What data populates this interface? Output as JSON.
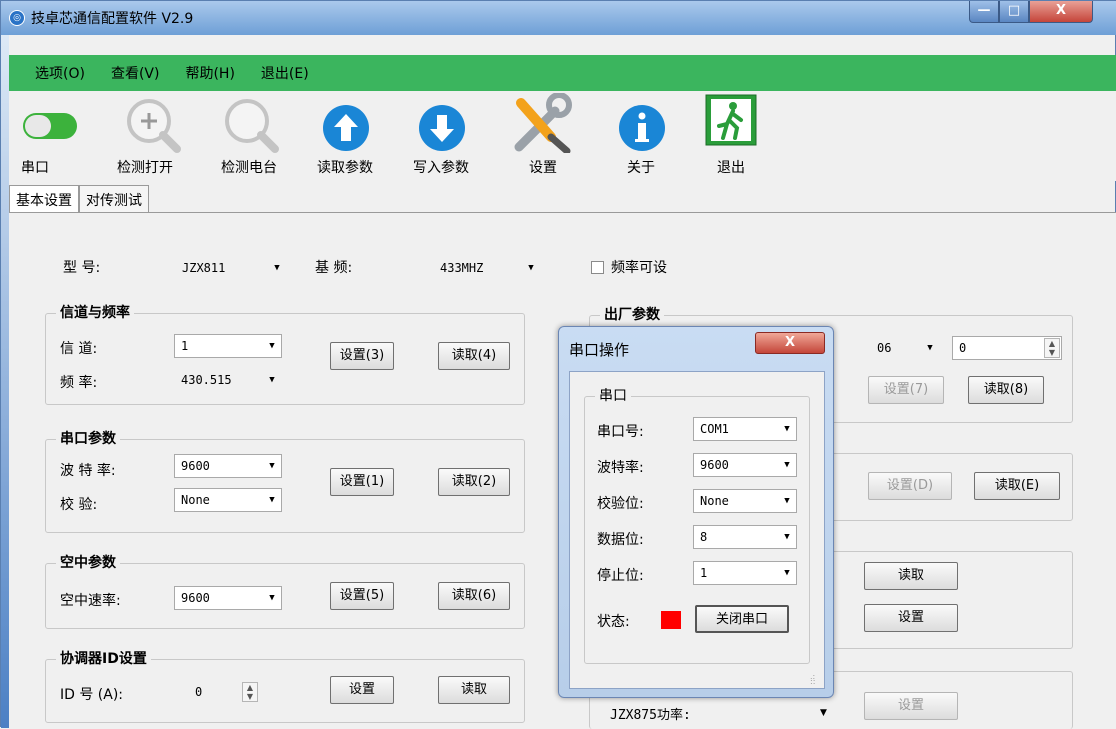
{
  "window": {
    "title": "技卓芯通信配置软件 V2.9",
    "app_icon": "wireless-logo-icon",
    "min": "—",
    "max": "□",
    "close": "X"
  },
  "menu": [
    "选项(O)",
    "查看(V)",
    "帮助(H)",
    "退出(E)"
  ],
  "toolbar": [
    {
      "label": "串口",
      "icon": "toggle-switch-icon"
    },
    {
      "label": "检测打开",
      "icon": "zoom-in-icon"
    },
    {
      "label": "检测电台",
      "icon": "magnifier-icon"
    },
    {
      "label": "读取参数",
      "icon": "arrow-up-circle-icon"
    },
    {
      "label": "写入参数",
      "icon": "arrow-down-circle-icon"
    },
    {
      "label": "设置",
      "icon": "tools-icon"
    },
    {
      "label": "关于",
      "icon": "info-icon"
    },
    {
      "label": "退出",
      "icon": "exit-door-icon"
    }
  ],
  "tabs": [
    "基本设置",
    "对传测试"
  ],
  "model": {
    "label_model": "型    号:",
    "model_value": "JZX811",
    "label_base": "基    频:",
    "base_value": "433MHZ",
    "freq_settable": "频率可设"
  },
  "channel_group": {
    "title": "信道与频率",
    "channel_label": "信    道:",
    "channel_value": "1",
    "freq_label": "频    率:",
    "freq_value": "430.515",
    "set": "设置(3)",
    "read": "读取(4)"
  },
  "serial_group": {
    "title": "串口参数",
    "baud_label": "波 特 率:",
    "baud_value": "9600",
    "parity_label": "校    验:",
    "parity_value": "None",
    "set": "设置(1)",
    "read": "读取(2)"
  },
  "air_group": {
    "title": "空中参数",
    "rate_label": "空中速率:",
    "rate_value": "9600",
    "set": "设置(5)",
    "read": "读取(6)"
  },
  "coord_group": {
    "title": "协调器ID设置",
    "id_label": "ID 号 (A):",
    "id_value": "0",
    "set": "设置",
    "read": "读取"
  },
  "factory_group": {
    "title": "出厂参数",
    "combo_value": "06",
    "spin_value": "0",
    "set": "设置(7)",
    "read": "读取(8)"
  },
  "right_group2": {
    "set": "设置(D)",
    "read": "读取(E)"
  },
  "right_group3": {
    "read": "读取",
    "set": "设置"
  },
  "right_group4": {
    "power_label": "JZX875功率:",
    "set": "设置"
  },
  "dialog": {
    "title": "串口操作",
    "close": "X",
    "group_title": "串口",
    "port_label": "串口号:",
    "port_value": "COM1",
    "baud_label": "波特率:",
    "baud_value": "9600",
    "parity_label": "校验位:",
    "parity_value": "None",
    "data_label": "数据位:",
    "data_value": "8",
    "stop_label": "停止位:",
    "stop_value": "1",
    "status_label": "状态:",
    "status_color": "#ff0000",
    "toggle_button": "关闭串口"
  }
}
